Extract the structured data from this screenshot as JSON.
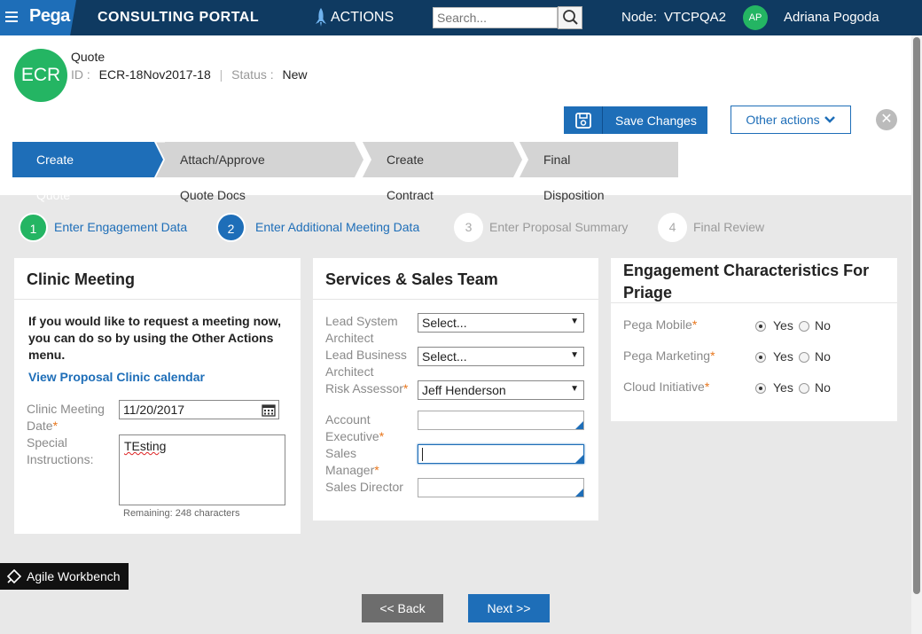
{
  "topbar": {
    "logo": "Pega",
    "portal_title": "CONSULTING PORTAL",
    "actions_label": "ACTIONS",
    "search_placeholder": "Search...",
    "node_label": "Node:",
    "node_value": "VTCPQA2",
    "user_initials": "AP",
    "user_name": "Adriana Pogoda"
  },
  "case": {
    "avatar_text": "ECR",
    "title": "Quote",
    "id_label": "ID :",
    "id_value": "ECR-18Nov2017-18",
    "status_label": "Status :",
    "status_value": "New",
    "save_label": "Save Changes",
    "other_actions_label": "Other actions"
  },
  "stages": [
    {
      "label": "Create Quote",
      "active": true
    },
    {
      "label": "Attach/Approve Quote Docs",
      "active": false
    },
    {
      "label": "Create Contract",
      "active": false
    },
    {
      "label": "Final Disposition",
      "active": false
    }
  ],
  "steps": [
    {
      "num": "1",
      "label": "Enter Engagement Data",
      "state": "done"
    },
    {
      "num": "2",
      "label": "Enter Additional Meeting Data",
      "state": "current"
    },
    {
      "num": "3",
      "label": "Enter Proposal Summary",
      "state": "future"
    },
    {
      "num": "4",
      "label": "Final Review",
      "state": "future"
    }
  ],
  "clinic": {
    "title": "Clinic Meeting",
    "instruction": "If you would like to request a meeting now, you can do so by using the Other Actions menu.",
    "calendar_link": "View Proposal Clinic calendar",
    "date_label": "Clinic Meeting Date",
    "date_value": "11/20/2017",
    "special_label": "Special Instructions:",
    "special_value": "TEsting",
    "remaining": "Remaining: 248 characters"
  },
  "services": {
    "title": "Services & Sales Team",
    "lead_sys_label": "Lead System Architect",
    "lead_sys_value": "Select...",
    "lead_biz_label": "Lead Business Architect",
    "lead_biz_value": "Select...",
    "risk_label": "Risk Assessor",
    "risk_value": "Jeff Henderson",
    "acct_label": "Account Executive",
    "sales_mgr_label": "Sales Manager",
    "sales_dir_label": "Sales Director"
  },
  "engagement": {
    "title": "Engagement Characteristics For Priage",
    "rows": [
      {
        "label": "Pega Mobile",
        "selected": "Yes"
      },
      {
        "label": "Pega Marketing",
        "selected": "Yes"
      },
      {
        "label": "Cloud Initiative",
        "selected": "Yes"
      }
    ],
    "yes": "Yes",
    "no": "No"
  },
  "footer": {
    "workbench_label": "Agile Workbench",
    "back_label": "<< Back",
    "next_label": "Next >>"
  },
  "colors": {
    "brand_blue": "#1e6eb8",
    "topbar": "#0f3a61",
    "success_green": "#24b563",
    "required_orange": "#e8761c"
  }
}
